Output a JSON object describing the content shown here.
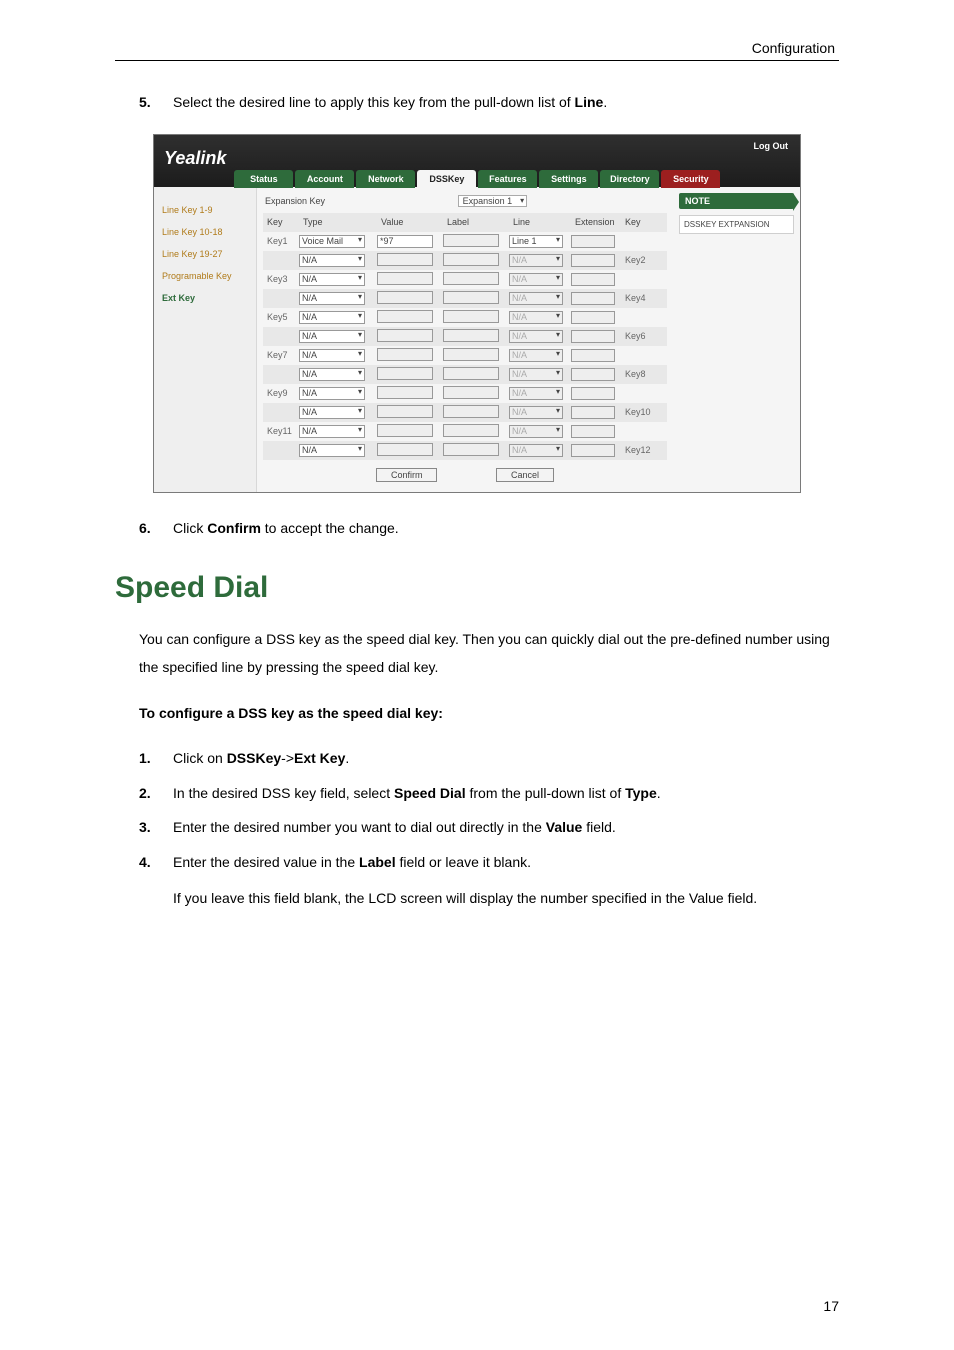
{
  "header": {
    "section": "Configuration"
  },
  "step5": {
    "num": "5.",
    "prefix": "Select the desired line to apply this key from the pull-down list of ",
    "bold": "Line",
    "suffix": "."
  },
  "shot": {
    "logo": "Yealink",
    "logout": "Log Out",
    "tabs": [
      "Status",
      "Account",
      "Network",
      "DSSKey",
      "Features",
      "Settings",
      "Directory",
      "Security"
    ],
    "sidenav": [
      "Line Key 1-9",
      "Line Key 10-18",
      "Line Key 19-27",
      "Programable Key",
      "Ext Key"
    ],
    "expansionTitle": "Expansion Key",
    "expansionSel": "Expansion 1",
    "columns": [
      "Key",
      "Type",
      "Value",
      "Label",
      "Line",
      "Extension",
      "Key"
    ],
    "rows": [
      {
        "k": "Key1",
        "type": "Voice Mail",
        "value": "*97",
        "line": "Line 1",
        "ext": "",
        "k2": ""
      },
      {
        "k": "",
        "type": "N/A",
        "value": "",
        "line": "N/A",
        "ext": "",
        "k2": "Key2"
      },
      {
        "k": "Key3",
        "type": "N/A",
        "value": "",
        "line": "N/A",
        "ext": "",
        "k2": ""
      },
      {
        "k": "",
        "type": "N/A",
        "value": "",
        "line": "N/A",
        "ext": "",
        "k2": "Key4"
      },
      {
        "k": "Key5",
        "type": "N/A",
        "value": "",
        "line": "N/A",
        "ext": "",
        "k2": ""
      },
      {
        "k": "",
        "type": "N/A",
        "value": "",
        "line": "N/A",
        "ext": "",
        "k2": "Key6"
      },
      {
        "k": "Key7",
        "type": "N/A",
        "value": "",
        "line": "N/A",
        "ext": "",
        "k2": ""
      },
      {
        "k": "",
        "type": "N/A",
        "value": "",
        "line": "N/A",
        "ext": "",
        "k2": "Key8"
      },
      {
        "k": "Key9",
        "type": "N/A",
        "value": "",
        "line": "N/A",
        "ext": "",
        "k2": ""
      },
      {
        "k": "",
        "type": "N/A",
        "value": "",
        "line": "N/A",
        "ext": "",
        "k2": "Key10"
      },
      {
        "k": "Key11",
        "type": "N/A",
        "value": "",
        "line": "N/A",
        "ext": "",
        "k2": ""
      },
      {
        "k": "",
        "type": "N/A",
        "value": "",
        "line": "N/A",
        "ext": "",
        "k2": "Key12"
      }
    ],
    "buttons": {
      "confirm": "Confirm",
      "cancel": "Cancel"
    },
    "note": {
      "title": "NOTE",
      "body": "DSSKEY EXTPANSION"
    }
  },
  "step6": {
    "num": "6.",
    "prefix": "Click ",
    "bold": "Confirm",
    "suffix": " to accept the change."
  },
  "h2": "Speed Dial",
  "intro": "You can configure a DSS key as the speed dial key. Then you can quickly dial out the pre-defined number using the specified line by pressing the speed dial key.",
  "toConfigure": "To configure a DSS key as the speed dial key:",
  "steps": {
    "s1": {
      "num": "1.",
      "p1": "Click on ",
      "b1": "DSSKey",
      "p2": "->",
      "b2": "Ext Key",
      "p3": "."
    },
    "s2": {
      "num": "2.",
      "p1": "In the desired DSS key field, select ",
      "b1": "Speed Dial",
      "p2": " from the pull-down list of ",
      "b2": "Type",
      "p3": "."
    },
    "s3": {
      "num": "3.",
      "p1": "Enter the desired number you want to dial out directly in the ",
      "b1": "Value",
      "p2": " field."
    },
    "s4": {
      "num": "4.",
      "p1": "Enter the desired value in the ",
      "b1": "Label",
      "p2": " field or leave it blank."
    },
    "s4b": "If you leave this field blank, the LCD screen will display the number specified in the Value field."
  },
  "pageNum": "17"
}
